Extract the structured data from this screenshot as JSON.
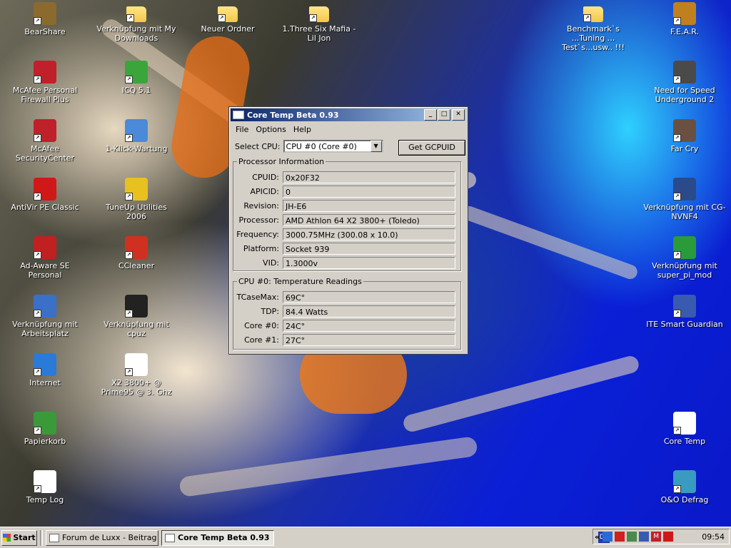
{
  "desktop_left": [
    {
      "label": "BearShare",
      "icon": "bear-icon",
      "color": "#8b6a2e"
    },
    {
      "label": "McAfee Personal Firewall Plus",
      "icon": "firewall-icon",
      "color": "#c0202a"
    },
    {
      "label": "McAfee SecurityCenter",
      "icon": "mcafee-icon",
      "color": "#c0202a"
    },
    {
      "label": "AntiVir PE Classic",
      "icon": "antivir-icon",
      "color": "#d01818"
    },
    {
      "label": "Ad-Aware SE Personal",
      "icon": "adaware-icon",
      "color": "#c02020"
    },
    {
      "label": "Verknüpfung mit Arbeitsplatz",
      "icon": "computer-icon",
      "color": "#3a70c8"
    },
    {
      "label": "Internet",
      "icon": "internet-explorer-icon",
      "color": "#2a7ad8"
    },
    {
      "label": "Papierkorb",
      "icon": "recycle-bin-icon",
      "color": "#3a9a3a"
    },
    {
      "label": "Temp Log",
      "icon": "text-file-icon",
      "color": "#ffffff"
    }
  ],
  "desktop_col2": [
    {
      "label": "Verknüpfung mit My Downloads",
      "icon": "folder-icon"
    },
    {
      "label": "ICQ 5.1",
      "icon": "icq-icon",
      "color": "#3aa53a"
    },
    {
      "label": "1-Klick-Wartung",
      "icon": "wartung-icon",
      "color": "#4a8ad8"
    },
    {
      "label": "TuneUp Utilities 2006",
      "icon": "tuneup-icon",
      "color": "#e8c020"
    },
    {
      "label": "CCleaner",
      "icon": "ccleaner-icon",
      "color": "#d03020"
    },
    {
      "label": "Verknüpfung mit cpuz",
      "icon": "cpu-chip-icon",
      "color": "#222222"
    },
    {
      "label": "X2 3800+ @ Prime95 @ 3. Ghz",
      "icon": "document-icon",
      "color": "#ffffff"
    }
  ],
  "desktop_top": [
    {
      "label": "Neuer Ordner",
      "icon": "folder-icon"
    },
    {
      "label": "1.Three Six Mafia - Lil Jon",
      "icon": "folder-icon"
    },
    {
      "label": "Benchmark`s ...Tuning ... Test`s...usw.. !!!",
      "icon": "folder-icon"
    }
  ],
  "desktop_right": [
    {
      "label": "F.E.A.R.",
      "icon": "fear-icon",
      "color": "#c08020"
    },
    {
      "label": "Need for Speed Underground 2",
      "icon": "nfs-icon",
      "color": "#4a4a4a"
    },
    {
      "label": "Far Cry",
      "icon": "farcry-icon",
      "color": "#6a5040"
    },
    {
      "label": "Verknüpfung mit CG-NVNF4",
      "icon": "gauge-icon",
      "color": "#2a4a8a"
    },
    {
      "label": "Verknüpfung mit super_pi_mod",
      "icon": "superpi-icon",
      "color": "#2a9a3a"
    },
    {
      "label": "ITE Smart Guardian",
      "icon": "ite-icon",
      "color": "#3a5ab0"
    },
    {
      "label": "Core Temp",
      "icon": "window-app-icon",
      "color": "#ffffff"
    },
    {
      "label": "O&O Defrag",
      "icon": "defrag-icon",
      "color": "#3a9ac0"
    }
  ],
  "window": {
    "title": "Core Temp Beta 0.93",
    "menu": [
      "File",
      "Options",
      "Help"
    ],
    "select_cpu_label": "Select CPU:",
    "select_cpu_value": "CPU #0 (Core #0)",
    "gcpuid_button": "Get GCPUID",
    "proc_group": "Processor Information",
    "proc_rows": [
      {
        "label": "CPUID:",
        "value": "0x20F32"
      },
      {
        "label": "APICID:",
        "value": "0"
      },
      {
        "label": "Revision:",
        "value": "JH-E6"
      },
      {
        "label": "Processor:",
        "value": "AMD Athlon 64 X2 3800+ (Toledo)"
      },
      {
        "label": "Frequency:",
        "value": "3000.75MHz (300.08 x 10.0)"
      },
      {
        "label": "Platform:",
        "value": "Socket 939"
      },
      {
        "label": "VID:",
        "value": "1.3000v"
      }
    ],
    "temp_group": "CPU #0: Temperature Readings",
    "temp_rows": [
      {
        "label": "TCaseMax:",
        "value": "69C°"
      },
      {
        "label": "TDP:",
        "value": "84.4 Watts"
      },
      {
        "label": "Core #0:",
        "value": "24C°"
      },
      {
        "label": "Core #1:",
        "value": "27C°"
      }
    ]
  },
  "taskbar": {
    "start": "Start",
    "tasks": [
      "Forum de Luxx - Beitrag ...",
      "Core Temp Beta 0.93"
    ],
    "lang": "DE",
    "tray_arrow": "«",
    "clock": "09:54"
  }
}
